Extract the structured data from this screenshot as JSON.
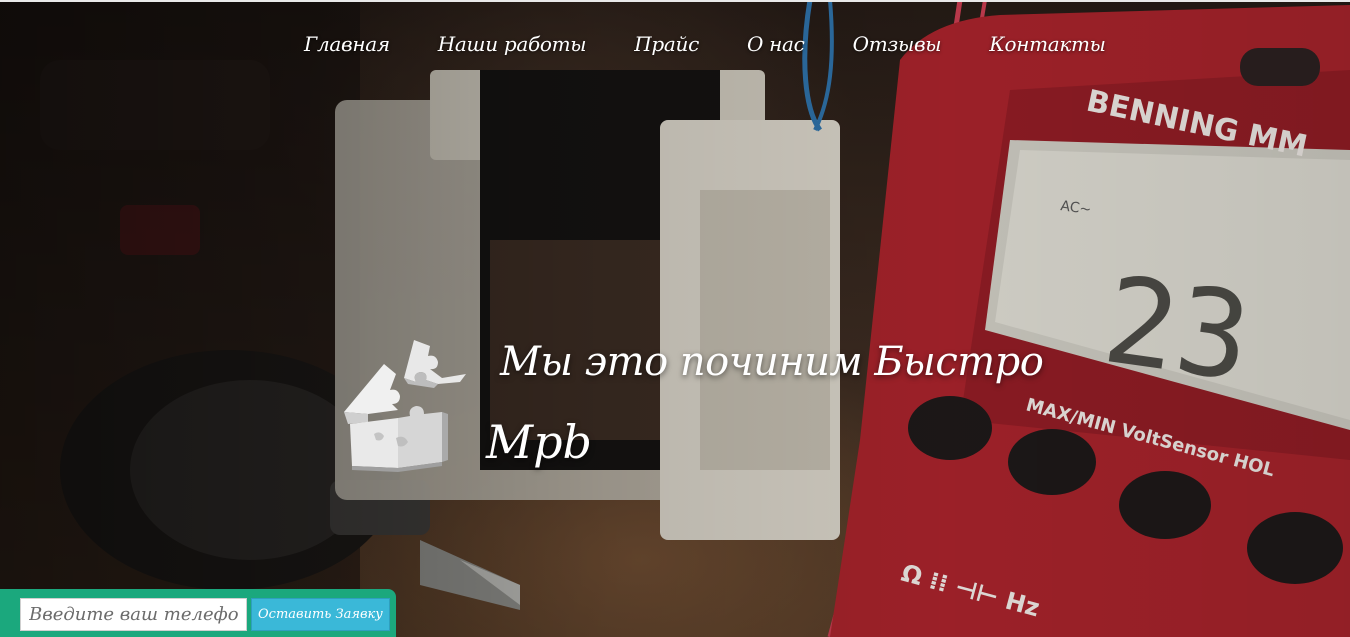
{
  "nav": {
    "items": [
      {
        "label": "Главная"
      },
      {
        "label": "Наши работы"
      },
      {
        "label": "Прайс"
      },
      {
        "label": "О нас"
      },
      {
        "label": "Отзывы"
      },
      {
        "label": "Контакты"
      }
    ]
  },
  "hero": {
    "headline": "Мы это починим Быстро",
    "brand": "Mpb",
    "background_photo_text": "BENNING MM",
    "logo_icon": "puzzle-house-icon"
  },
  "callback": {
    "phone_placeholder": "Введите ваш телефон",
    "submit_label": "Оставить Заявку"
  },
  "colors": {
    "callback_bar": "#1ba87d",
    "submit_button": "#3ab8d8",
    "text": "#ffffff"
  }
}
